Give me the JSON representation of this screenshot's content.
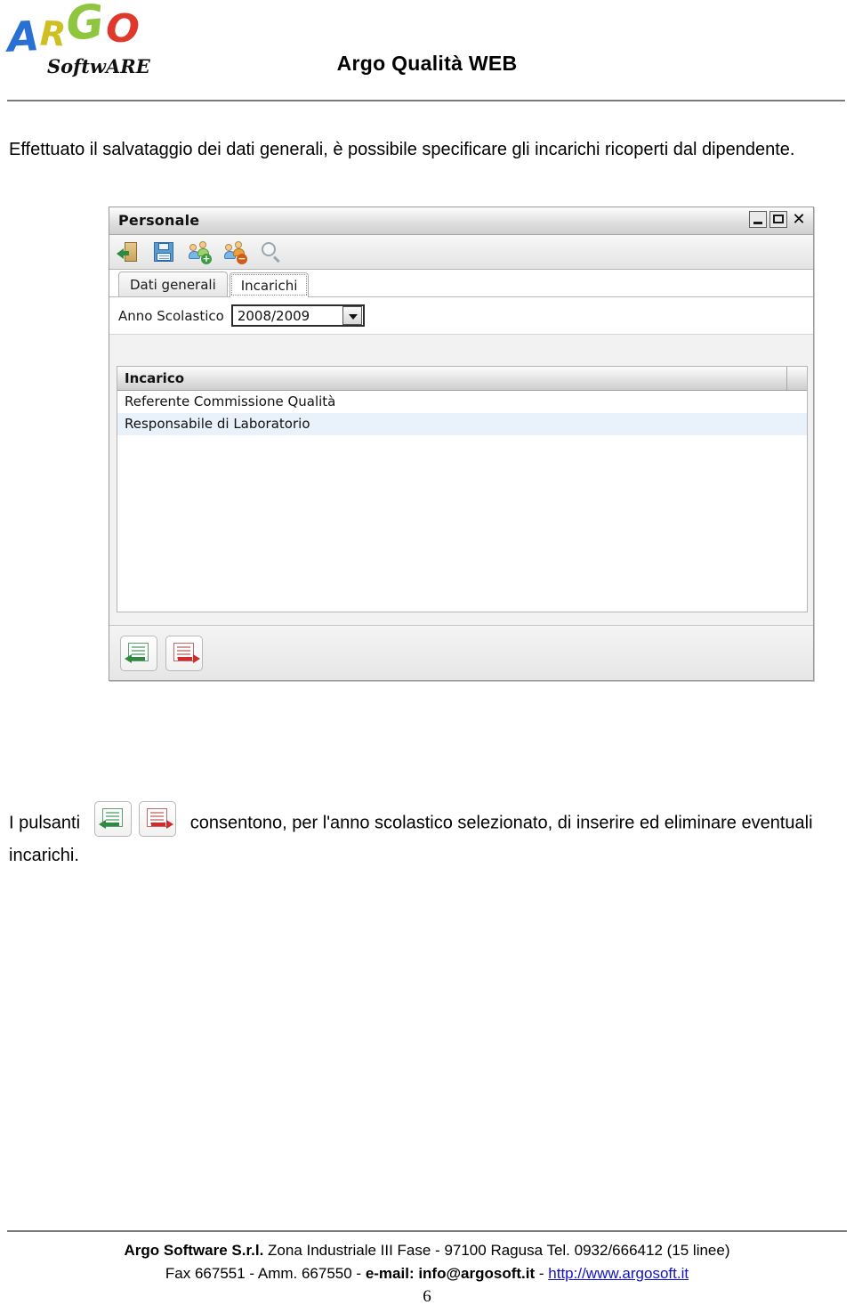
{
  "header": {
    "title": "Argo Qualità WEB",
    "logo": {
      "letter_a": "A",
      "letter_r": "R",
      "letter_g": "G",
      "letter_o": "O",
      "subtitle": "SoftwARE",
      "color_a": "#2a6fd4",
      "color_r": "#cfc022",
      "color_g": "#8ec63f",
      "color_o": "#e0392b"
    }
  },
  "body": {
    "intro_paragraph": "Effettuato il salvataggio dei dati generali, è possibile specificare gli incarichi ricoperti dal dipendente.",
    "buttons_paragraph_pre": "I pulsanti",
    "buttons_paragraph_post": "consentono, per l'anno scolastico selezionato, di inserire ed eliminare eventuali incarichi."
  },
  "window": {
    "title": "Personale",
    "controls": {
      "minimize": "minimize-icon",
      "maximize": "maximize-icon",
      "close": "✕"
    },
    "toolbar": [
      {
        "name": "exit-icon",
        "label": "Esci"
      },
      {
        "name": "save-icon",
        "label": "Salva"
      },
      {
        "name": "add-person-icon",
        "label": "Nuovo"
      },
      {
        "name": "delete-person-icon",
        "label": "Elimina"
      },
      {
        "name": "search-icon",
        "label": "Cerca"
      }
    ],
    "tabs": [
      {
        "label": "Dati generali",
        "active": false
      },
      {
        "label": "Incarichi",
        "active": true
      }
    ],
    "filter": {
      "label": "Anno Scolastico",
      "selected_value": "2008/2009"
    },
    "table": {
      "columns": [
        "Incarico"
      ],
      "rows": [
        [
          "Referente Commissione Qualità"
        ],
        [
          "Responsabile di Laboratorio"
        ]
      ]
    },
    "footer_buttons": [
      {
        "name": "insert-incarico-button",
        "icon": "doc-green-left-arrow-icon"
      },
      {
        "name": "delete-incarico-button",
        "icon": "doc-red-right-arrow-icon"
      }
    ]
  },
  "page_footer": {
    "company": "Argo Software S.r.l.",
    "address": " Zona Industriale III Fase - 97100 Ragusa Tel. 0932/666412 (15 linee)",
    "line2_pre": "Fax 667551 - Amm. 667550 - ",
    "line2_email_label": "e-mail: info@argosoft.it",
    "line2_sep": " - ",
    "website": "http://www.argosoft.it",
    "page_number": "6"
  }
}
